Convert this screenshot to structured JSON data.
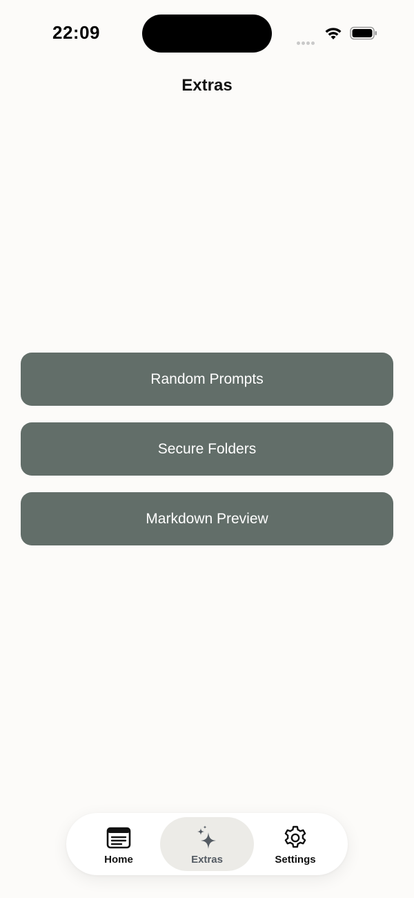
{
  "status_bar": {
    "time": "22:09"
  },
  "nav": {
    "title": "Extras"
  },
  "menu": {
    "items": [
      {
        "label": "Random Prompts"
      },
      {
        "label": "Secure Folders"
      },
      {
        "label": "Markdown Preview"
      }
    ]
  },
  "tab_bar": {
    "tabs": [
      {
        "label": "Home",
        "icon": "notes-icon",
        "active": false
      },
      {
        "label": "Extras",
        "icon": "sparkles-icon",
        "active": true
      },
      {
        "label": "Settings",
        "icon": "gear-icon",
        "active": false
      }
    ]
  },
  "colors": {
    "background": "#fcfbf9",
    "button": "#626e69",
    "button_text": "#ffffff",
    "active_tab_bg": "#ecebe7",
    "active_tab_fg": "#545b63"
  }
}
